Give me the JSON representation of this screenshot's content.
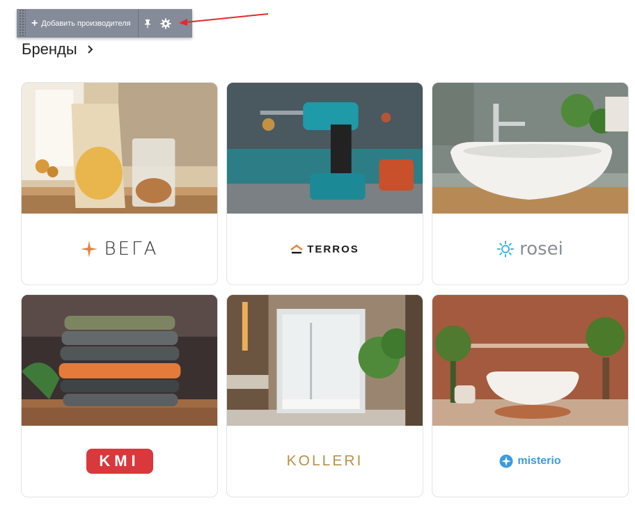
{
  "toolbar": {
    "add_label": "Добавить производителя",
    "icons": [
      "plus-icon",
      "pin-icon",
      "gear-icon"
    ],
    "background": "#858b98"
  },
  "annotation": {
    "arrow_color": "#e02b2b"
  },
  "section": {
    "title": "Бренды",
    "chevron_icon": "chevron-right-icon"
  },
  "brands": [
    {
      "name": "ВЕГА",
      "photo": "food-packages-photo",
      "accent": "#e5823a"
    },
    {
      "name": "TERROS",
      "photo": "cordless-drill-photo",
      "accent": "#e5823a"
    },
    {
      "name": "rosei",
      "photo": "bathroom-sink-photo",
      "accent": "#3bb3e6"
    },
    {
      "name": "KMI",
      "photo": "folded-clothes-photo",
      "accent": "#d9383c"
    },
    {
      "name": "KOLLERI",
      "photo": "shower-cabin-photo",
      "accent": "#b59247"
    },
    {
      "name": "misterio",
      "photo": "bathtub-room-photo",
      "accent": "#3b9ae1"
    }
  ]
}
